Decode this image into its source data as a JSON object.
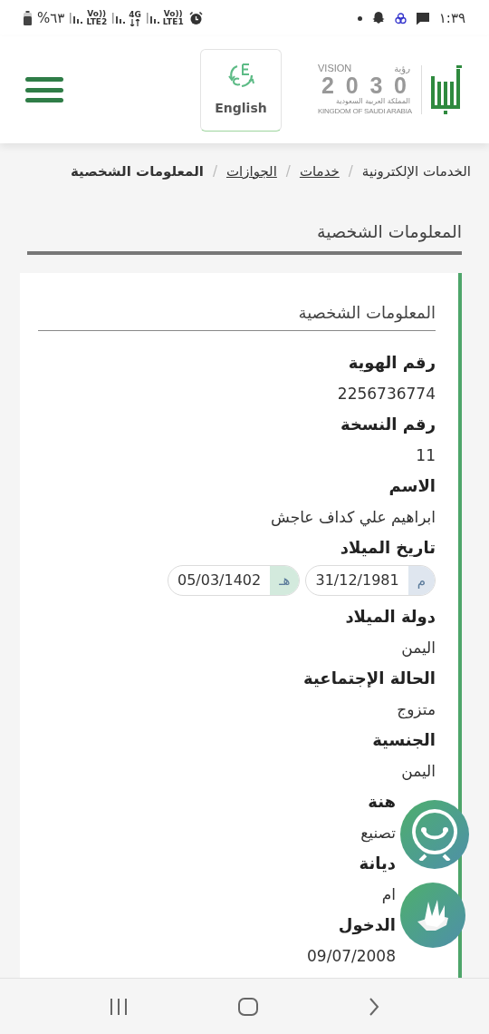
{
  "status_bar": {
    "time": "١:٣٩",
    "battery": "%٦٣",
    "sim_labels": [
      {
        "top": "Vo))",
        "bottom": "LTE1"
      },
      {
        "top": "4G"
      },
      {
        "top": "Vo))",
        "bottom": "LTE2"
      }
    ]
  },
  "header": {
    "language_button": "English",
    "vision_logo": {
      "word": "VISION",
      "arabic": "رؤية",
      "year": "2030",
      "country_ar": "المملكة العربية السعودية",
      "country_en": "KINGDOM OF SAUDI ARABIA"
    }
  },
  "breadcrumb_separator": "/",
  "breadcrumb": [
    {
      "label": "الخدمات الإلكترونية",
      "link": false,
      "current": false
    },
    {
      "label": "خدمات",
      "link": true,
      "current": false
    },
    {
      "label": "الجوازات",
      "link": true,
      "current": false
    },
    {
      "label": "المعلومات الشخصية",
      "link": false,
      "current": true
    }
  ],
  "page_title": "المعلومات الشخصية",
  "card": {
    "title": "المعلومات الشخصية",
    "fields": [
      {
        "kind": "text",
        "label": "رقم الهوية",
        "value": "2256736774"
      },
      {
        "kind": "text",
        "label": "رقم النسخة",
        "value": "11"
      },
      {
        "kind": "text",
        "label": "الاسم",
        "value": "ابراهيم علي كداف عاجش"
      },
      {
        "kind": "dates",
        "label": "تاريخ الميلاد",
        "dates": [
          {
            "kind": "gregorian",
            "era": "م",
            "value": "31/12/1981"
          },
          {
            "kind": "hijri",
            "era": "هـ",
            "value": "05/03/1402"
          }
        ]
      },
      {
        "kind": "text",
        "label": "دولة الميلاد",
        "value": "اليمن"
      },
      {
        "kind": "text",
        "label": "الحالة الإجتماعية",
        "value": "متزوج"
      },
      {
        "kind": "text",
        "label": "الجنسية",
        "value": "اليمن"
      },
      {
        "kind": "text",
        "label": "هنة",
        "value": "تصنيع"
      },
      {
        "kind": "text",
        "label": "ديانة",
        "value": "ام"
      },
      {
        "kind": "text",
        "label": "الدخول",
        "value": "09/07/2008"
      }
    ]
  }
}
